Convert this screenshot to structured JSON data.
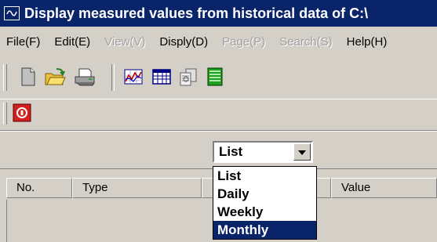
{
  "window": {
    "title": "Display measured values from historical data of C:\\",
    "app_icon": "wave-chart-icon"
  },
  "menubar": {
    "items": [
      {
        "label": "File(F)",
        "enabled": true
      },
      {
        "label": "Edit(E)",
        "enabled": true
      },
      {
        "label": "View(V)",
        "enabled": false
      },
      {
        "label": "Disply(D)",
        "enabled": true
      },
      {
        "label": "Page(P)",
        "enabled": false
      },
      {
        "label": "Search(S)",
        "enabled": false
      },
      {
        "label": "Help(H)",
        "enabled": true
      }
    ]
  },
  "toolbar": {
    "icons": [
      "new-document-icon",
      "open-folder-icon",
      "print-icon",
      "trend-chart-icon",
      "table-icon",
      "copy-pages-icon",
      "list-view-icon"
    ],
    "stop_icon": "stop-icon"
  },
  "view_selector": {
    "selected": "List",
    "options": [
      "List",
      "Daily",
      "Weekly",
      "Monthly"
    ],
    "highlighted": "Monthly"
  },
  "list": {
    "columns": [
      "No.",
      "Type",
      "",
      "Value"
    ]
  }
}
